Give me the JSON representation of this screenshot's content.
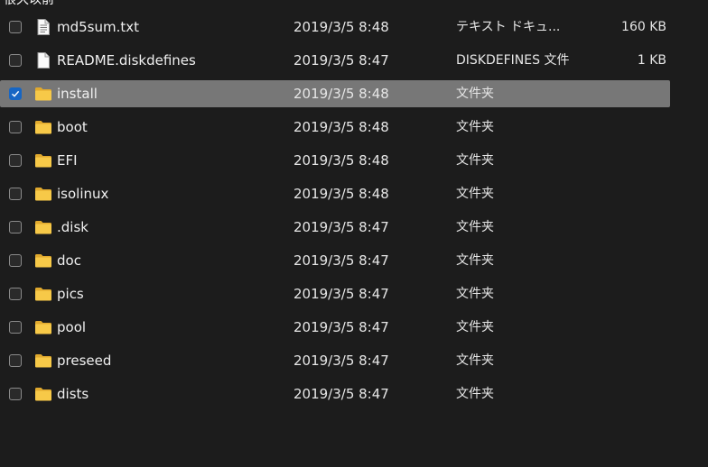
{
  "group_header": "很久以前",
  "files": [
    {
      "name": "md5sum.txt",
      "date": "2019/3/5 8:48",
      "type": "テキスト ドキュ...",
      "size": "160 KB",
      "icon": "text-file-icon",
      "checked": false,
      "selected": false
    },
    {
      "name": "README.diskdefines",
      "date": "2019/3/5 8:47",
      "type": "DISKDEFINES 文件",
      "size": "1 KB",
      "icon": "file-icon",
      "checked": false,
      "selected": false
    },
    {
      "name": "install",
      "date": "2019/3/5 8:48",
      "type": "文件夹",
      "size": "",
      "icon": "folder-icon",
      "checked": true,
      "selected": true
    },
    {
      "name": "boot",
      "date": "2019/3/5 8:48",
      "type": "文件夹",
      "size": "",
      "icon": "folder-icon",
      "checked": false,
      "selected": false
    },
    {
      "name": "EFI",
      "date": "2019/3/5 8:48",
      "type": "文件夹",
      "size": "",
      "icon": "folder-icon",
      "checked": false,
      "selected": false
    },
    {
      "name": "isolinux",
      "date": "2019/3/5 8:48",
      "type": "文件夹",
      "size": "",
      "icon": "folder-icon",
      "checked": false,
      "selected": false
    },
    {
      "name": ".disk",
      "date": "2019/3/5 8:47",
      "type": "文件夹",
      "size": "",
      "icon": "folder-icon",
      "checked": false,
      "selected": false
    },
    {
      "name": "doc",
      "date": "2019/3/5 8:47",
      "type": "文件夹",
      "size": "",
      "icon": "folder-icon",
      "checked": false,
      "selected": false
    },
    {
      "name": "pics",
      "date": "2019/3/5 8:47",
      "type": "文件夹",
      "size": "",
      "icon": "folder-icon",
      "checked": false,
      "selected": false
    },
    {
      "name": "pool",
      "date": "2019/3/5 8:47",
      "type": "文件夹",
      "size": "",
      "icon": "folder-icon",
      "checked": false,
      "selected": false
    },
    {
      "name": "preseed",
      "date": "2019/3/5 8:47",
      "type": "文件夹",
      "size": "",
      "icon": "folder-icon",
      "checked": false,
      "selected": false
    },
    {
      "name": "dists",
      "date": "2019/3/5 8:47",
      "type": "文件夹",
      "size": "",
      "icon": "folder-icon",
      "checked": false,
      "selected": false
    }
  ],
  "colors": {
    "background": "#1c1c1c",
    "selected_row": "#777777",
    "checkbox_checked": "#1766c4",
    "folder": "#f0c04c"
  }
}
